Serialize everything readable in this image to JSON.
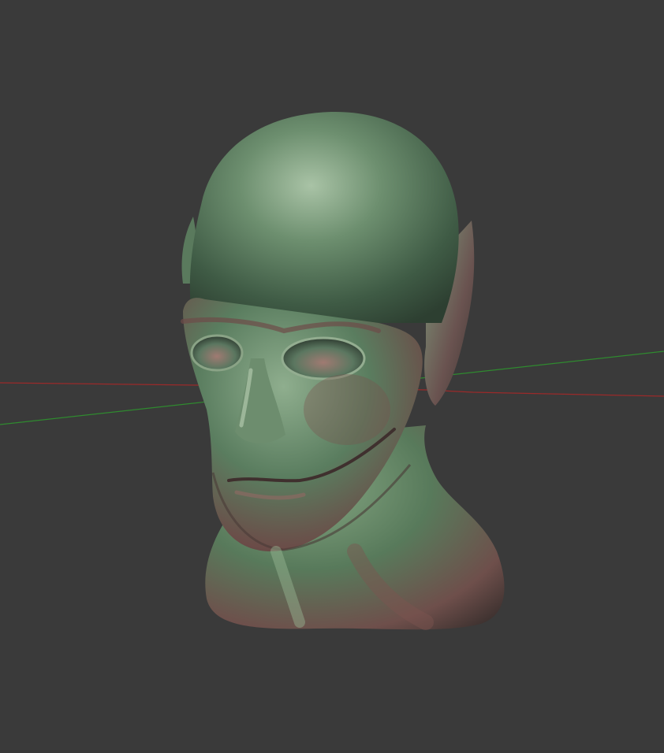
{
  "viewport": {
    "background_color": "#3a3a3a",
    "object_shown": "sculpted head",
    "material_color_primary": "#5f8a6a",
    "material_color_secondary": "#8a5a55"
  },
  "axes": {
    "x_axis_color": "#9a2a2a",
    "y_axis_color": "#2f8a2f"
  }
}
